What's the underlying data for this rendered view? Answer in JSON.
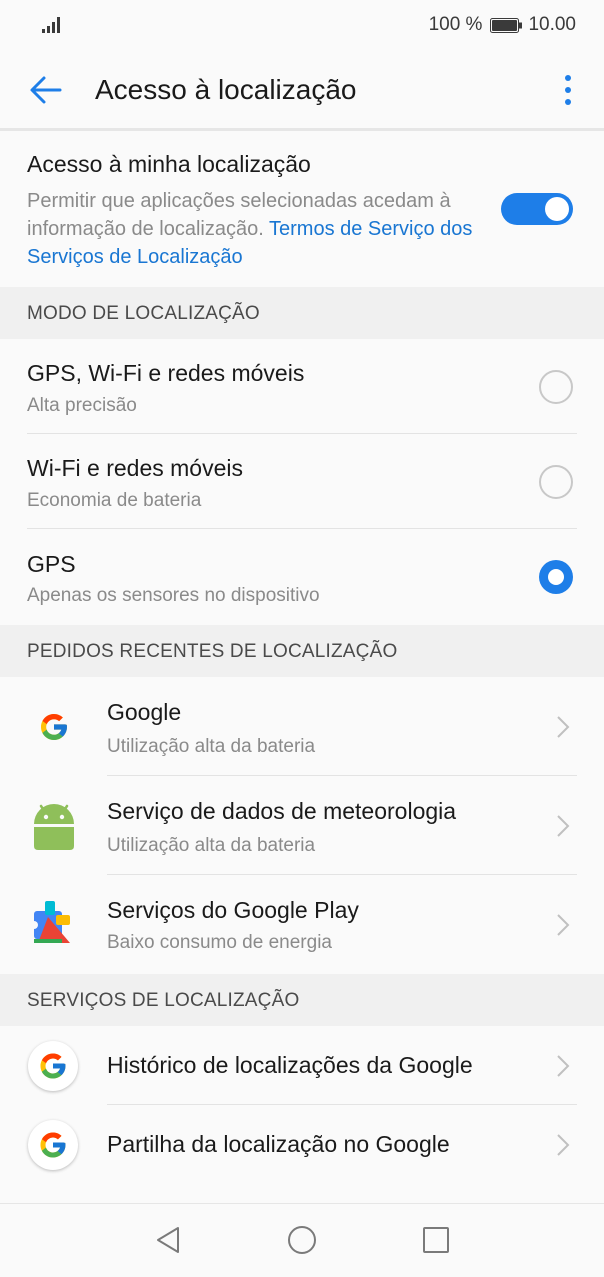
{
  "status": {
    "battery_text": "100 %",
    "time": "10.00"
  },
  "app_bar": {
    "title": "Acesso à localização"
  },
  "access": {
    "title": "Acesso à minha localização",
    "desc": "Permitir que aplicações selecionadas acedam à informação de localização. ",
    "link": "Termos de Serviço dos Serviços de Localização",
    "enabled": true
  },
  "mode": {
    "header": "MODO DE LOCALIZAÇÃO",
    "options": [
      {
        "title": "GPS, Wi-Fi e redes móveis",
        "subtitle": "Alta precisão",
        "selected": false
      },
      {
        "title": "Wi-Fi e redes móveis",
        "subtitle": "Economia de bateria",
        "selected": false
      },
      {
        "title": "GPS",
        "subtitle": "Apenas os sensores no dispositivo",
        "selected": true
      }
    ]
  },
  "recent": {
    "header": "PEDIDOS RECENTES DE LOCALIZAÇÃO",
    "items": [
      {
        "title": "Google",
        "subtitle": "Utilização alta da bateria",
        "icon": "google-icon"
      },
      {
        "title": "Serviço de dados de meteorologia",
        "subtitle": "Utilização alta da bateria",
        "icon": "android-icon"
      },
      {
        "title": "Serviços do Google Play",
        "subtitle": "Baixo consumo de energia",
        "icon": "google-play-services-icon"
      }
    ]
  },
  "services": {
    "header": "SERVIÇOS DE LOCALIZAÇÃO",
    "items": [
      {
        "title": "Histórico de localizações da Google",
        "icon": "google-icon"
      },
      {
        "title": "Partilha da localização no Google",
        "icon": "google-icon"
      }
    ]
  },
  "colors": {
    "accent": "#1e7ee8",
    "link": "#1976d2",
    "header_bg": "#f0f0f0"
  }
}
